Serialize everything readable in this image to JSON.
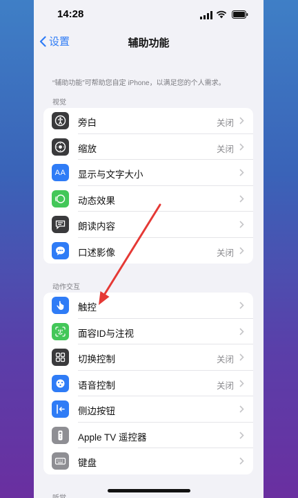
{
  "status": {
    "time": "14:28"
  },
  "nav": {
    "back_label": "设置",
    "title": "辅助功能"
  },
  "description": "“辅助功能”可帮助您自定 iPhone，以满足您的个人需求。",
  "sections": {
    "vision": {
      "header": "视觉",
      "items": [
        {
          "label": "旁白",
          "value": "关闭",
          "icon": "voiceover-icon",
          "color": "#3a3a3c"
        },
        {
          "label": "缩放",
          "value": "关闭",
          "icon": "zoom-icon",
          "color": "#3a3a3c"
        },
        {
          "label": "显示与文字大小",
          "value": "",
          "icon": "text-size-icon",
          "color": "#2f7cf6"
        },
        {
          "label": "动态效果",
          "value": "",
          "icon": "motion-icon",
          "color": "#43c759"
        },
        {
          "label": "朗读内容",
          "value": "",
          "icon": "spoken-content-icon",
          "color": "#3a3a3c"
        },
        {
          "label": "口述影像",
          "value": "关闭",
          "icon": "audio-description-icon",
          "color": "#2f7cf6"
        }
      ]
    },
    "interaction": {
      "header": "动作交互",
      "items": [
        {
          "label": "触控",
          "value": "",
          "icon": "touch-icon",
          "color": "#2f7cf6"
        },
        {
          "label": "面容ID与注视",
          "value": "",
          "icon": "face-id-icon",
          "color": "#43c759"
        },
        {
          "label": "切换控制",
          "value": "关闭",
          "icon": "switch-control-icon",
          "color": "#3a3a3c"
        },
        {
          "label": "语音控制",
          "value": "关闭",
          "icon": "voice-control-icon",
          "color": "#2f7cf6"
        },
        {
          "label": "侧边按钮",
          "value": "",
          "icon": "side-button-icon",
          "color": "#2f7cf6"
        },
        {
          "label": "Apple TV 遥控器",
          "value": "",
          "icon": "apple-tv-remote-icon",
          "color": "#8e8e93"
        },
        {
          "label": "键盘",
          "value": "",
          "icon": "keyboard-icon",
          "color": "#8e8e93"
        }
      ]
    },
    "hearing": {
      "header": "听觉"
    }
  },
  "colors": {
    "accent": "#2f7cf6",
    "annotation_arrow": "#e53935"
  }
}
